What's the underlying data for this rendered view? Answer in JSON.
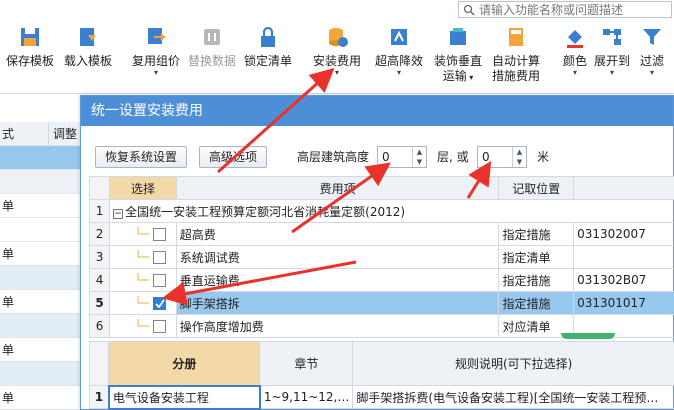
{
  "search": {
    "placeholder": "请输入功能名称或问题描述"
  },
  "ribbon": {
    "buttons": [
      {
        "label": "保存模板",
        "icon": "save-template-icon"
      },
      {
        "label": "载入模板",
        "icon": "load-template-icon"
      },
      {
        "label": "复用组价",
        "icon": "reuse-pricing-icon"
      },
      {
        "label": "替换数据",
        "icon": "replace-data-icon",
        "disabled": true
      },
      {
        "label": "锁定清单",
        "icon": "lock-icon"
      },
      {
        "label": "安装费用",
        "icon": "install-fee-icon"
      },
      {
        "label": "超高降效",
        "icon": "height-efficiency-icon"
      },
      {
        "label1": "装饰垂直",
        "label2": "运输",
        "icon": "vertical-transport-icon"
      },
      {
        "label1": "自动计算",
        "label2": "措施费用",
        "icon": "auto-calc-icon"
      },
      {
        "label": "颜色",
        "icon": "color-icon"
      },
      {
        "label": "展开到",
        "icon": "expand-icon"
      },
      {
        "label": "过滤",
        "icon": "filter-icon"
      }
    ]
  },
  "left": {
    "header1": "式",
    "header2": "调整",
    "rows": [
      "单",
      "单",
      "单",
      "单",
      "单"
    ]
  },
  "dialog": {
    "title": "统一设置安装费用",
    "restore_btn": "恢复系统设置",
    "advanced_btn": "高级选项",
    "height_label": "高层建筑高度",
    "height_value": "0",
    "floor_label": "层, 或",
    "floor_value": "0",
    "meter_label": "米",
    "table": {
      "headers": [
        "选择",
        "费用项",
        "记取位置",
        ""
      ],
      "rows": [
        {
          "num": "1",
          "item": "全国统一安装工程预算定额河北省消耗量定额(2012)",
          "pos": "",
          "code": "",
          "group": true
        },
        {
          "num": "2",
          "item": "超高费",
          "pos": "指定措施",
          "code": "031302007",
          "checked": false
        },
        {
          "num": "3",
          "item": "系统调试费",
          "pos": "指定清单",
          "code": "",
          "checked": false
        },
        {
          "num": "4",
          "item": "垂直运输费",
          "pos": "指定措施",
          "code": "031302B07",
          "checked": false
        },
        {
          "num": "5",
          "item": "脚手架搭拆",
          "pos": "指定措施",
          "code": "031301017",
          "checked": true
        },
        {
          "num": "6",
          "item": "操作高度增加费",
          "pos": "对应清单",
          "code": "",
          "checked": false
        }
      ]
    },
    "bottom": {
      "headers": [
        "分册",
        "章节",
        "规则说明(可下拉选择)"
      ],
      "row": {
        "num": "1",
        "book": "电气设备安装工程",
        "chapter": "1~9,11~12,…",
        "rule": "脚手架搭拆费(电气设备安装工程)[全国统一安装工程预…"
      }
    }
  },
  "colors": {
    "title_bar": "#4d8fd6",
    "selected_row": "#99c8ee",
    "arrow": "#e8322a"
  }
}
